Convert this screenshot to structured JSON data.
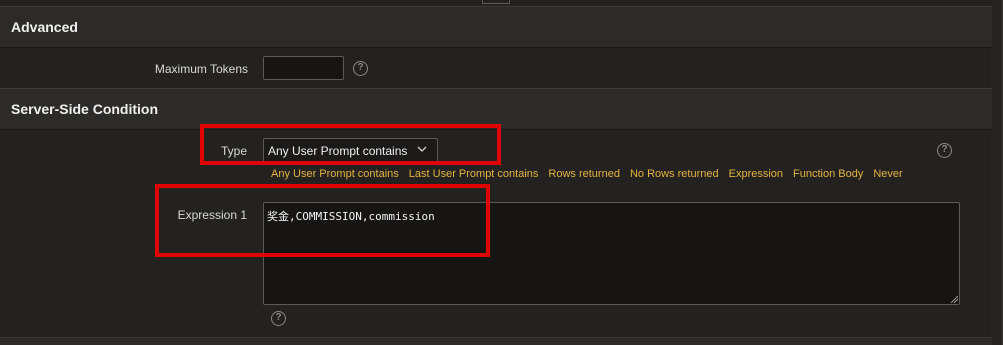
{
  "sections": {
    "advanced": {
      "title": "Advanced",
      "max_tokens_label": "Maximum Tokens",
      "max_tokens_value": ""
    },
    "server_side_condition": {
      "title": "Server-Side Condition",
      "type_label": "Type",
      "type_value": "Any User Prompt contains",
      "quick_picks": [
        "Any User Prompt contains",
        "Last User Prompt contains",
        "Rows returned",
        "No Rows returned",
        "Expression",
        "Function Body",
        "Never"
      ],
      "expression_label": "Expression 1",
      "expression_value": "奖金,COMMISSION,commission"
    }
  },
  "help_glyph": "?",
  "icons": [
    "question-circle-icon",
    "chevron-down-icon",
    "resize-grip-icon"
  ],
  "colors": {
    "background": "#232220",
    "section_header": "#2c2b29",
    "quick_pick_link": "#e5b33d",
    "annotation": "#e00000"
  }
}
